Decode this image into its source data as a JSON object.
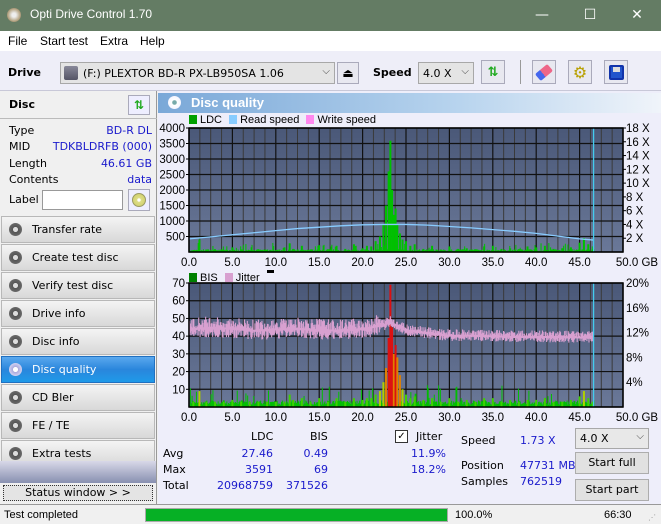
{
  "window": {
    "title": "Opti Drive Control 1.70",
    "minimize": "—",
    "maximize": "☐",
    "close": "✕"
  },
  "menu": [
    "File",
    "Start test",
    "Extra",
    "Help"
  ],
  "toolbar": {
    "drive_label": "Drive",
    "drive_value": "(F:)  PLEXTOR BD-R  PX-LB950SA 1.06",
    "speed_label": "Speed",
    "speed_value": "4.0 X"
  },
  "disc": {
    "header": "Disc",
    "type_label": "Type",
    "type_value": "BD-R DL",
    "mid_label": "MID",
    "mid_value": "TDKBLDRFB (000)",
    "length_label": "Length",
    "length_value": "46.61 GB",
    "contents_label": "Contents",
    "contents_value": "data",
    "label_label": "Label",
    "label_value": ""
  },
  "nav": [
    {
      "label": "Transfer rate",
      "active": false
    },
    {
      "label": "Create test disc",
      "active": false
    },
    {
      "label": "Verify test disc",
      "active": false
    },
    {
      "label": "Drive info",
      "active": false
    },
    {
      "label": "Disc info",
      "active": false
    },
    {
      "label": "Disc quality",
      "active": true
    },
    {
      "label": "CD Bler",
      "active": false
    },
    {
      "label": "FE / TE",
      "active": false
    },
    {
      "label": "Extra tests",
      "active": false
    }
  ],
  "status_window_label": "Status window > >",
  "panel_title": "Disc quality",
  "colors": {
    "ldc": "#00a000",
    "read_speed": "#88ccff",
    "write_speed": "#ff88ee",
    "bis": "#008000",
    "jitter": "#d8a0d0",
    "plot_bg": "#5a6a8a",
    "progress": "#06b025"
  },
  "chart_data": [
    {
      "type": "bar",
      "title": "LDC / Read speed",
      "legend": [
        "LDC",
        "Read speed",
        "Write speed"
      ],
      "xlabel": "GB",
      "xlim": [
        0,
        50
      ],
      "x_ticks": [
        "0.0",
        "5.0",
        "10.0",
        "15.0",
        "20.0",
        "25.0",
        "30.0",
        "35.0",
        "40.0",
        "45.0",
        "50.0 GB"
      ],
      "ylim": [
        0,
        4000
      ],
      "y_ticks": [
        "500",
        "1000",
        "1500",
        "2000",
        "2500",
        "3000",
        "3500",
        "4000"
      ],
      "y2lim": [
        0,
        18
      ],
      "y2_ticks": [
        "2 X",
        "4 X",
        "6 X",
        "8 X",
        "10 X",
        "12 X",
        "14 X",
        "16 X",
        "18 X"
      ],
      "end_marker_gb": 46.61,
      "ldc_series": {
        "name": "LDC",
        "x": [
          0.5,
          1.2,
          2.0,
          3.0,
          4.0,
          5.0,
          6.0,
          7.0,
          8.0,
          9.0,
          10.0,
          11.0,
          11.6,
          12.0,
          13.0,
          14.0,
          15.0,
          16.0,
          17.0,
          18.0,
          19.0,
          20.0,
          20.5,
          21.0,
          21.5,
          22.0,
          22.4,
          22.7,
          23.0,
          23.2,
          23.4,
          23.6,
          23.8,
          24.0,
          24.3,
          24.6,
          25.0,
          25.5,
          26.0,
          27.0,
          28.0,
          29.0,
          30.0,
          31.0,
          32.0,
          33.0,
          34.0,
          35.0,
          36.0,
          37.0,
          38.0,
          39.0,
          40.0,
          41.0,
          42.0,
          43.0,
          44.0,
          45.0,
          45.5,
          46.0,
          46.5
        ],
        "values": [
          60,
          400,
          80,
          90,
          70,
          150,
          80,
          60,
          90,
          70,
          60,
          150,
          280,
          100,
          200,
          80,
          220,
          90,
          200,
          100,
          250,
          120,
          200,
          180,
          350,
          500,
          900,
          1500,
          2600,
          3591,
          2000,
          1200,
          1400,
          900,
          600,
          400,
          350,
          200,
          250,
          100,
          200,
          80,
          180,
          100,
          120,
          90,
          180,
          200,
          100,
          120,
          90,
          180,
          150,
          200,
          100,
          120,
          150,
          300,
          450,
          250,
          100
        ]
      },
      "read_speed_series": {
        "name": "Read speed",
        "x": [
          0,
          2.5,
          5,
          7.5,
          10,
          12.5,
          15,
          17.5,
          20,
          22.5,
          25,
          27.5,
          30,
          32.5,
          35,
          37.5,
          40,
          42.5,
          45,
          46.61
        ],
        "values": [
          1.9,
          2.2,
          2.5,
          2.8,
          3.1,
          3.4,
          3.6,
          3.8,
          3.95,
          4.0,
          4.0,
          3.9,
          3.7,
          3.5,
          3.25,
          3.0,
          2.7,
          2.3,
          1.9,
          1.73
        ]
      }
    },
    {
      "type": "bar",
      "title": "BIS / Jitter",
      "legend": [
        "BIS",
        "Jitter"
      ],
      "xlabel": "GB",
      "xlim": [
        0,
        50
      ],
      "x_ticks": [
        "0.0",
        "5.0",
        "10.0",
        "15.0",
        "20.0",
        "25.0",
        "30.0",
        "35.0",
        "40.0",
        "45.0",
        "50.0 GB"
      ],
      "ylim": [
        0,
        70
      ],
      "y_ticks": [
        "10",
        "20",
        "30",
        "40",
        "50",
        "60",
        "70"
      ],
      "y2lim": [
        0,
        20
      ],
      "y2_ticks": [
        "4%",
        "8%",
        "12%",
        "16%",
        "20%"
      ],
      "end_marker_gb": 46.61,
      "bis_series": {
        "name": "BIS",
        "x": [
          0.5,
          1.2,
          2,
          3,
          4,
          5,
          6,
          7,
          8,
          9,
          10,
          11,
          11.6,
          12,
          13,
          14,
          15,
          16,
          17,
          18,
          19,
          20,
          20.5,
          21,
          21.5,
          22,
          22.4,
          22.7,
          23.0,
          23.2,
          23.4,
          23.6,
          23.8,
          24.0,
          24.3,
          24.6,
          25,
          25.5,
          26,
          27,
          28,
          29,
          30,
          31,
          32,
          33,
          34,
          35,
          36,
          37,
          38,
          39,
          40,
          41,
          42,
          43,
          44,
          45,
          45.5,
          46,
          46.5
        ],
        "values": [
          3,
          9,
          3,
          3,
          3,
          4,
          3,
          3,
          3,
          3,
          3,
          3,
          7,
          4,
          5,
          3,
          5,
          3,
          5,
          3,
          5,
          4,
          5,
          5,
          7,
          9,
          14,
          22,
          39,
          69,
          45,
          30,
          35,
          28,
          18,
          10,
          7,
          5,
          6,
          4,
          5,
          3,
          5,
          3,
          4,
          3,
          5,
          5,
          3,
          4,
          3,
          4,
          4,
          5,
          3,
          3,
          4,
          6,
          9,
          5,
          3
        ]
      },
      "jitter_series": {
        "name": "Jitter",
        "x": [
          0,
          2.5,
          5,
          7.5,
          10,
          12.5,
          15,
          17.5,
          20,
          22.5,
          23.2,
          24,
          25,
          27.5,
          30,
          32.5,
          35,
          37.5,
          40,
          42.5,
          45,
          46.61
        ],
        "values": [
          12.5,
          12.8,
          12.6,
          12.3,
          12.5,
          12.6,
          12.4,
          12.3,
          12.6,
          13.2,
          13.8,
          13.0,
          12.4,
          11.9,
          11.5,
          11.5,
          11.4,
          11.3,
          11.3,
          11.3,
          11.2,
          11.2
        ]
      }
    }
  ],
  "stats": {
    "col_ldc": "LDC",
    "col_bis": "BIS",
    "avg_label": "Avg",
    "max_label": "Max",
    "total_label": "Total",
    "ldc_avg": "27.46",
    "ldc_max": "3591",
    "ldc_total": "20968759",
    "bis_avg": "0.49",
    "bis_max": "69",
    "bis_total": "371526",
    "jitter_label": "Jitter",
    "jitter_checked": true,
    "jitter_avg": "11.9%",
    "jitter_max": "18.2%",
    "speed_label": "Speed",
    "speed_value": "1.73 X",
    "position_label": "Position",
    "position_value": "47731 MB",
    "samples_label": "Samples",
    "samples_value": "762519",
    "speed_select": "4.0 X",
    "start_full": "Start full",
    "start_part": "Start part"
  },
  "status": {
    "text": "Test completed",
    "progress_pct": 100.0,
    "progress_text": "100.0%",
    "time": "66:30"
  }
}
